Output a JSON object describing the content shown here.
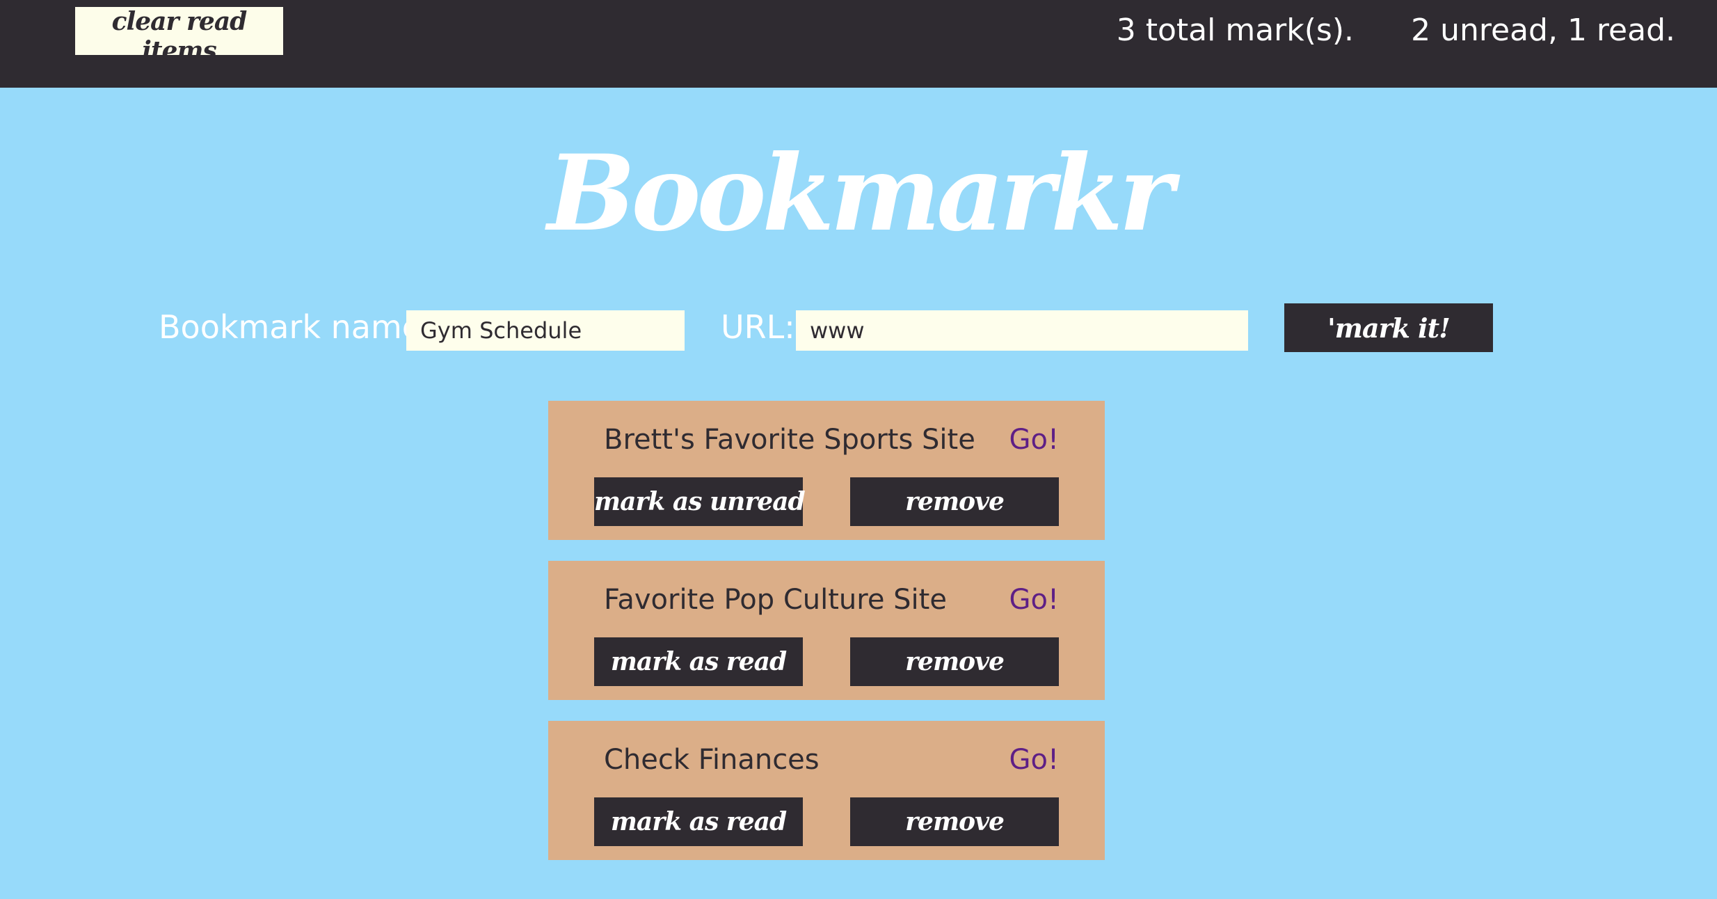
{
  "topbar": {
    "clear_label": "clear read items",
    "total_text": "3 total mark(s).",
    "read_text": "2 unread, 1 read."
  },
  "header": {
    "title": "Bookmarkr"
  },
  "form": {
    "name_label": "Bookmark name:",
    "name_value": "Gym Schedule",
    "url_label": "URL:",
    "url_value": "www",
    "submit_label": "'mark it!"
  },
  "bookmarks": [
    {
      "name": "Brett's Favorite Sports Site",
      "go_label": "Go!",
      "toggle_label": "mark as unread",
      "remove_label": "remove"
    },
    {
      "name": "Favorite Pop Culture Site",
      "go_label": "Go!",
      "toggle_label": "mark as read",
      "remove_label": "remove"
    },
    {
      "name": "Check Finances",
      "go_label": "Go!",
      "toggle_label": "mark as read",
      "remove_label": "remove"
    }
  ],
  "colors": {
    "background": "#97dafa",
    "dark": "#2f2b31",
    "card": "#dbae88",
    "input": "#fefeec",
    "link": "#5e1f86"
  }
}
